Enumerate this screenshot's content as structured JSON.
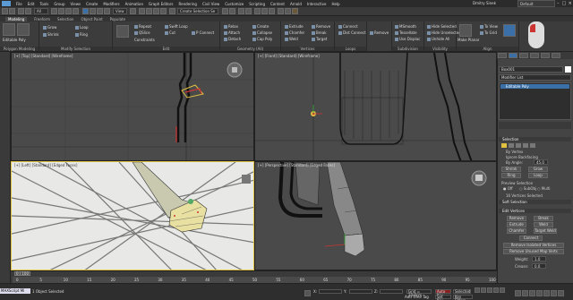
{
  "menu": {
    "items": [
      "File",
      "Edit",
      "Tools",
      "Group",
      "Views",
      "Create",
      "Modifiers",
      "Animation",
      "Graph Editors",
      "Rendering",
      "Civil View",
      "Customize",
      "Scripting",
      "Content",
      "Arnold",
      "Interactive",
      "Help"
    ],
    "user": "Dmitry Sinek",
    "workspace_label": "Workspaces:",
    "workspace_value": "Default"
  },
  "toolbar": {
    "selection_filter": "All",
    "view_dropdown": "View",
    "create_selection_set": "Create Selection Se"
  },
  "ribbon": {
    "tabs": [
      "Modeling",
      "Freeform",
      "Selection",
      "Object Paint",
      "Populate"
    ],
    "active_tab": "Modeling",
    "groups": {
      "polygon_modeling": "Polygon Modeling",
      "modify_selection": "Modify Selection",
      "edit": "Edit",
      "geometry_all": "Geometry (All)",
      "vertices": "Vertices",
      "loops": "Loops",
      "subdivision": "Subdivision",
      "visibility": "Visibility",
      "align": "Align"
    },
    "pm_items": [
      "Editable Poly"
    ],
    "modsel_items": [
      "Grow",
      "Shrink",
      "Loop",
      "Ring"
    ],
    "edit_items": [
      "Repeat",
      "QSlice",
      "Swift Loop",
      "Cut",
      "P Connect",
      "Constraints"
    ],
    "geo_items": [
      "Relax",
      "Create",
      "Attach",
      "Collapse",
      "Detach",
      "Cap Poly"
    ],
    "vert_items": [
      "Extrude",
      "Remove",
      "Chamfer",
      "Break",
      "Weld",
      "Target"
    ],
    "loop_items": [
      "Connect",
      "Dist Connect",
      "Remove"
    ],
    "subdiv_items": [
      "MSmooth",
      "Tessellate",
      "Use Displac"
    ],
    "vis_items": [
      "Hide Selected",
      "Hide Unselected",
      "Unhide All"
    ],
    "align_items": [
      "Make Planar",
      "To View",
      "To Grid"
    ]
  },
  "viewports": {
    "top_left": "[+] [Top] [Standard] [Wireframe]",
    "top_right": "[+] [Front] [Standard] [Wireframe]",
    "bottom_left": "[+] [Left] [Standard] [Edged Faces]",
    "bottom_right": "[+] [Perspective] [Standard] [Edged Faces]"
  },
  "command_panel": {
    "object_name": "Box001",
    "modifier_list": "Modifier List",
    "stack_item": "Editable Poly",
    "selection_header": "Selection",
    "by_vertex": "By Vertex",
    "ignore_backfacing": "Ignore Backfacing",
    "by_angle": "By Angle:",
    "by_angle_value": "45.0",
    "shrink": "Shrink",
    "grow": "Grow",
    "ring": "Ring",
    "loop": "Loop",
    "preview_selection": "Preview Selection",
    "off": "Off",
    "subobj": "SubObj",
    "multi": "Multi",
    "selected_count": "16 Vertices Selected",
    "soft_selection": "Soft Selection",
    "edit_vertices_header": "Edit Vertices",
    "remove": "Remove",
    "break": "Break",
    "extrude": "Extrude",
    "weld": "Weld",
    "chamfer": "Chamfer",
    "target_weld": "Target Weld",
    "connect": "Connect",
    "remove_isolated": "Remove Isolated Vertices",
    "remove_unused": "Remove Unused Map Verts",
    "weight_label": "Weight:",
    "weight_value": "1.0",
    "crease_label": "Crease:",
    "crease_value": "0.0"
  },
  "timeline": {
    "frame_display": "0 / 100",
    "ticks": [
      "0",
      "5",
      "10",
      "15",
      "20",
      "25",
      "30",
      "35",
      "40",
      "45",
      "50",
      "55",
      "60",
      "65",
      "70",
      "75",
      "80",
      "85",
      "90",
      "95",
      "100"
    ]
  },
  "status": {
    "maxscript": "MAXScript Mi",
    "selection": "1 Object Selected",
    "x_label": "X:",
    "y_label": "Y:",
    "z_label": "Z:",
    "grid": "Grid = 10,0cm",
    "add_time_tag": "Add Time Tag",
    "auto_key": "Auto Key",
    "set_key": "Set Key",
    "selected": "Selected",
    "key_filters": "Key Filters..."
  }
}
